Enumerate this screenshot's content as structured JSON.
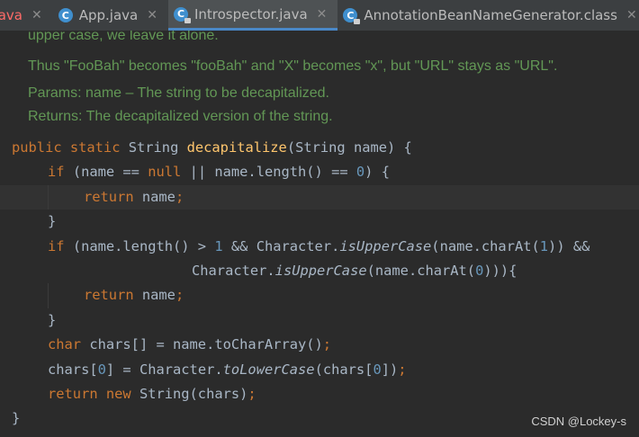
{
  "tabs": [
    {
      "label": "r.java",
      "close": "✕",
      "error": true
    },
    {
      "icon": "C",
      "label": "App.java",
      "close": "✕"
    },
    {
      "icon": "C",
      "label": "Introspector.java",
      "close": "✕",
      "active": true
    },
    {
      "icon": "C",
      "label": "AnnotationBeanNameGenerator.class",
      "close": "✕"
    }
  ],
  "doc": {
    "line1": "upper case, we leave it alone.",
    "line2": "Thus \"FooBah\" becomes \"fooBah\" and \"X\" becomes \"x\", but \"URL\" stays as \"URL\".",
    "params": "Params:  name – The string to be decapitalized.",
    "returns": "Returns: The decapitalized version of the string."
  },
  "code": {
    "l1": {
      "a": "public static ",
      "b": "String ",
      "c": "decapitalize",
      "d": "(String name) {"
    },
    "l2": {
      "a": "if ",
      "b": "(name == ",
      "c": "null ",
      "d": "|| name.length() == ",
      "e": "0",
      "f": ") {"
    },
    "l3": {
      "a": "return ",
      "b": "name",
      "c": ";"
    },
    "l4": {
      "a": "}"
    },
    "l5": {
      "a": "if ",
      "b": "(name.length() > ",
      "c": "1 ",
      "d": "&& Character.",
      "e": "isUpperCase",
      "f": "(name.charAt(",
      "g": "1",
      "h": ")) &&"
    },
    "l6": {
      "a": "Character.",
      "b": "isUpperCase",
      "c": "(name.charAt(",
      "d": "0",
      "e": "))){"
    },
    "l7": {
      "a": "return ",
      "b": "name",
      "c": ";"
    },
    "l8": {
      "a": "}"
    },
    "l9": {
      "a": "char ",
      "b": "chars[] = name.toCharArray()",
      "c": ";"
    },
    "l10": {
      "a": "chars[",
      "b": "0",
      "c": "] = Character.",
      "d": "toLowerCase",
      "e": "(chars[",
      "f": "0",
      "g": "])",
      "h": ";"
    },
    "l11": {
      "a": "return new ",
      "b": "String(chars)",
      "c": ";"
    },
    "l12": {
      "a": "}"
    }
  },
  "watermark": "CSDN @Lockey-s"
}
